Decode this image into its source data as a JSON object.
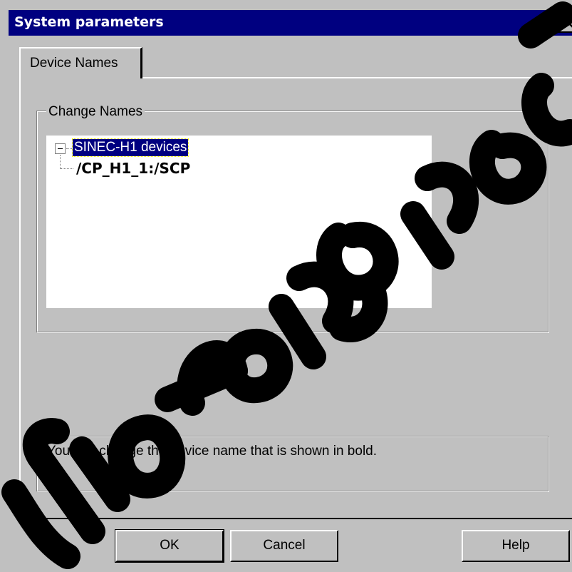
{
  "window": {
    "title": "System parameters"
  },
  "tabs": [
    {
      "label": "Device Names",
      "active": true
    }
  ],
  "group": {
    "label": "Change Names"
  },
  "tree": {
    "root": {
      "label": "SINEC-H1 devices",
      "expanded": true,
      "selected": true
    },
    "children": [
      {
        "label": "/CP_H1_1:/SCP"
      }
    ]
  },
  "info": {
    "text": "You can change the device name that is shown in bold."
  },
  "buttons": {
    "ok": "OK",
    "cancel": "Cancel",
    "help": "Help"
  },
  "colors": {
    "titlebar": "#000080",
    "face": "#c0c0c0",
    "selection": "#000080"
  }
}
